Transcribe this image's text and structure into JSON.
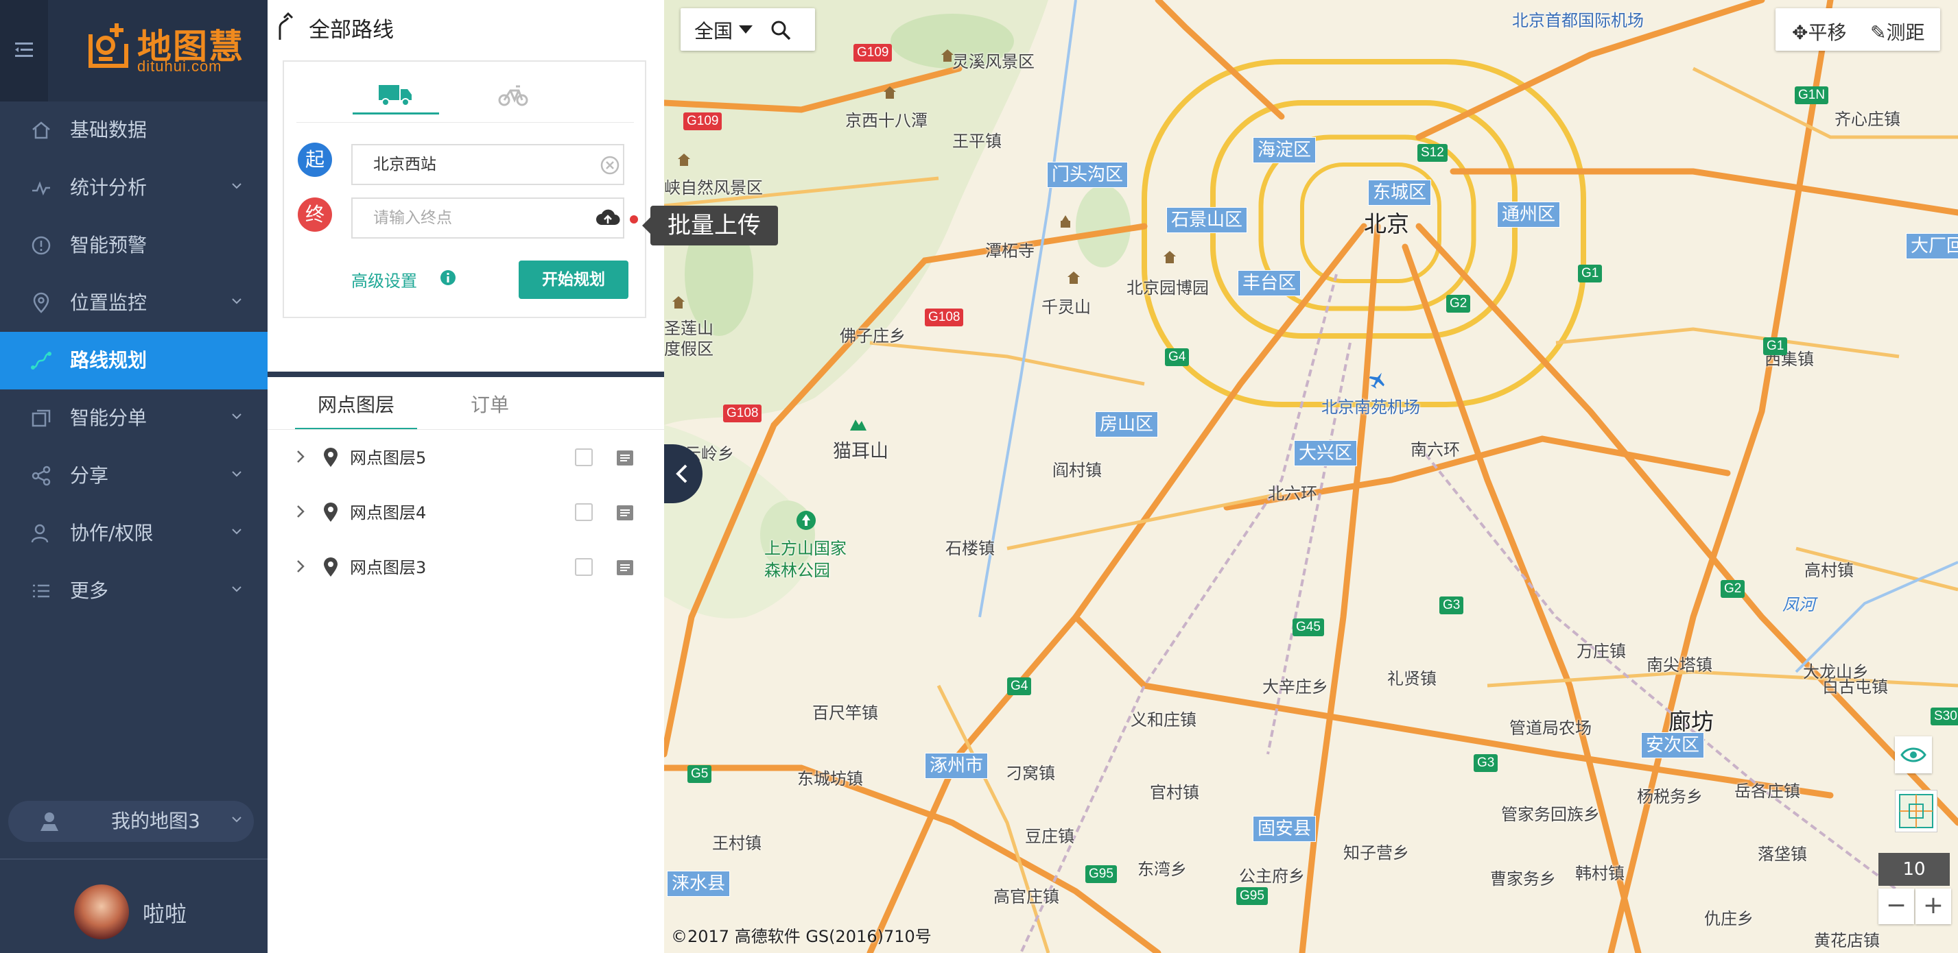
{
  "brand": {
    "name": "地图慧",
    "sub": "dituhui.com",
    "color": "#f08a1e"
  },
  "sidebar": {
    "items": [
      {
        "label": "基础数据",
        "icon": "home-icon",
        "has_chevron": false
      },
      {
        "label": "统计分析",
        "icon": "trend-icon",
        "has_chevron": true
      },
      {
        "label": "智能预警",
        "icon": "alert-icon",
        "has_chevron": false
      },
      {
        "label": "位置监控",
        "icon": "location-icon",
        "has_chevron": true
      },
      {
        "label": "路线规划",
        "icon": "route-icon",
        "has_chevron": false,
        "active": true
      },
      {
        "label": "智能分单",
        "icon": "split-icon",
        "has_chevron": true
      },
      {
        "label": "分享",
        "icon": "share-icon",
        "has_chevron": true
      },
      {
        "label": "协作/权限",
        "icon": "user-icon",
        "has_chevron": true
      },
      {
        "label": "更多",
        "icon": "list-icon",
        "has_chevron": true
      }
    ],
    "my_map": "我的地图3",
    "username": "啦啦"
  },
  "panel": {
    "title": "全部路线",
    "start_badge": "起",
    "end_badge": "终",
    "start_value": "北京西站",
    "end_placeholder": "请输入终点",
    "advanced": "高级设置",
    "start_button": "开始规划",
    "tooltip": "批量上传",
    "tabs": [
      "网点图层",
      "订单"
    ],
    "layers": [
      "网点图层5",
      "网点图层4",
      "网点图层3"
    ]
  },
  "map": {
    "region": "全国",
    "tools": {
      "pan": "平移",
      "measure": "测距"
    },
    "zoom": "10",
    "copyright": "©2017 高德软件 GS(2016)710号",
    "city_label": "北京",
    "langfang_label": "廊坊",
    "districts": [
      "海淀区",
      "东城区",
      "门头沟区",
      "石景山区",
      "通州区",
      "丰台区",
      "房山区",
      "大兴区",
      "涿州市",
      "固安县",
      "安次区",
      "涞水县",
      "大厂回"
    ],
    "places": [
      "北京首都国际机场",
      "灵溪风景区",
      "京西十八潭",
      "王平镇",
      "峡自然风景区",
      "潭柘寺",
      "千灵山",
      "北京园博园",
      "佛子庄乡",
      "圣莲山度假区",
      "霞云岭乡",
      "猫耳山",
      "上方山国家森林公园",
      "阎村镇",
      "北京南苑机场",
      "石楼镇",
      "百尺竿镇",
      "东城坊镇",
      "王村镇",
      "刁窝镇",
      "官村镇",
      "豆庄镇",
      "高官庄镇",
      "东湾乡",
      "义和庄镇",
      "大辛庄乡",
      "礼贤镇",
      "知子营乡",
      "公主府乡",
      "管道局农场",
      "万庄镇",
      "南尖塔镇",
      "杨税务乡",
      "岳各庄镇",
      "管家务回族乡",
      "曹家务乡",
      "韩村镇",
      "高村镇",
      "白古屯镇",
      "落垡镇",
      "仇庄乡",
      "黄花店镇",
      "凤河",
      "西集镇",
      "齐心庄镇",
      "南六环",
      "北六环",
      "大龙山乡"
    ],
    "highways": [
      "G109",
      "G109",
      "G108",
      "G108",
      "G4",
      "G4",
      "G45",
      "G3",
      "G3",
      "G95",
      "G95",
      "G5",
      "G1",
      "G1",
      "G1N",
      "G2",
      "G2",
      "S12",
      "S30",
      "G1",
      "G2"
    ]
  },
  "colors": {
    "sidebar_bg": "#2c3a52",
    "active": "#1d8ee6",
    "accent": "#1fa896",
    "end_red": "#e54848",
    "start_blue": "#2a7cd8"
  }
}
